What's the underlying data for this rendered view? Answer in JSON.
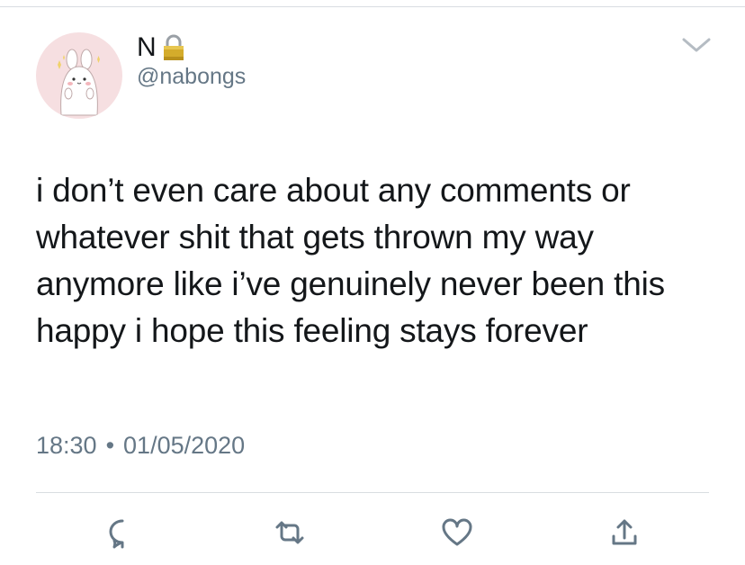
{
  "tweet": {
    "display_name": "N",
    "handle": "@nabongs",
    "text": "i don’t even care about any comments or whatever shit that gets thrown my way anymore like i’ve genuinely never been this happy i hope this feeling stays forever",
    "time": "18:30",
    "separator": "•",
    "date": "01/05/2020"
  },
  "icons": {
    "avatar": "bunny-avatar-icon",
    "protected": "lock-icon",
    "menu": "chevron-down-icon",
    "actions": [
      "reply-icon",
      "retweet-icon",
      "like-icon",
      "share-icon"
    ]
  },
  "colors": {
    "text": "#14171a",
    "secondary": "#657786",
    "divider": "#d9dde1",
    "action_icon": "#657786",
    "avatar_bg": "#f6dfe1",
    "lock_gold": "#c9a227"
  }
}
